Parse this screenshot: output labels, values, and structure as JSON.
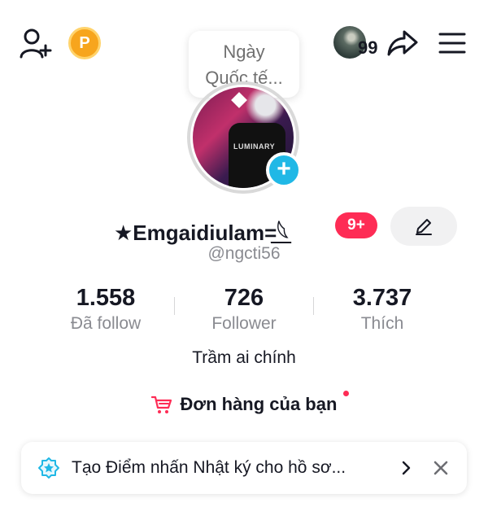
{
  "header": {
    "add_friend_icon": "person-plus-icon",
    "coin_icon": "points-coin-icon",
    "coin_letter": "P",
    "friends_count": "99",
    "share_icon": "share-arrow-icon",
    "menu_icon": "hamburger-menu-icon"
  },
  "bubble": {
    "line1": "Ngày",
    "line2": "Quốc tế..."
  },
  "profile": {
    "avatar_shirt_text": "LUMINARY",
    "add_icon": "plus-icon",
    "display_name": "★Emgaidiulam=̲͟𓆩",
    "notification_badge": "9+",
    "edit_icon": "pencil-icon",
    "handle": "@ngcti56"
  },
  "stats": [
    {
      "value": "1.558",
      "label": "Đã follow"
    },
    {
      "value": "726",
      "label": "Follower"
    },
    {
      "value": "3.737",
      "label": "Thích"
    }
  ],
  "bio": "Trầm ai chính",
  "orders": {
    "icon": "shopping-cart-icon",
    "label": "Đơn hàng của bạn"
  },
  "highlight_card": {
    "icon": "star-badge-icon",
    "text": "Tạo Điểm nhấn Nhật ký cho hồ sơ...",
    "chevron_icon": "chevron-right-icon",
    "close_icon": "close-icon"
  },
  "colors": {
    "accent_red": "#fe2c55",
    "add_blue": "#20b8e6",
    "coin_orange": "#f7a51d",
    "muted_text": "#8a8b91"
  }
}
